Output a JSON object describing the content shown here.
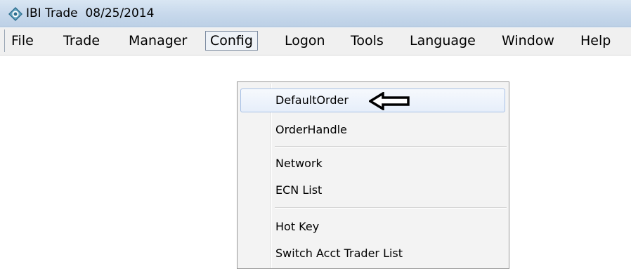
{
  "window": {
    "app_name": "IBI Trade",
    "date": "08/25/2014",
    "icon": "ibi-app-icon"
  },
  "menubar": {
    "items": [
      "File",
      "Trade",
      "Manager",
      "Config",
      "Logon",
      "Tools",
      "Language",
      "Window",
      "Help"
    ],
    "active_item": "Config"
  },
  "config_menu": {
    "items": [
      {
        "label": "DefaultOrder",
        "highlighted": true
      },
      {
        "label": "OrderHandle"
      },
      {
        "label": "Network"
      },
      {
        "label": "ECN List"
      },
      {
        "label": "Hot Key"
      },
      {
        "label": "Switch Acct Trader List"
      }
    ]
  },
  "annotation": {
    "icon": "left-arrow-icon",
    "points_to": "DefaultOrder"
  },
  "colors": {
    "titlebar": "#c8d9ec",
    "menubar": "#f0f0f0",
    "menu_background": "#f3f3f3",
    "highlight_border": "#a8c1e6"
  }
}
